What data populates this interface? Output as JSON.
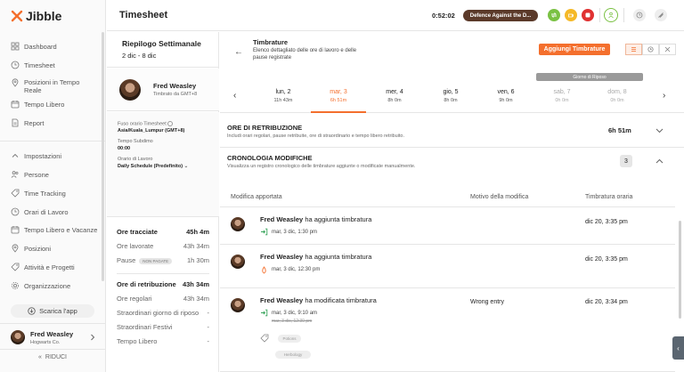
{
  "brand": {
    "name": "Jibble"
  },
  "sidebar": {
    "items_top": [
      {
        "label": "Dashboard",
        "icon": "grid-icon"
      },
      {
        "label": "Timesheet",
        "icon": "clock-icon"
      },
      {
        "label": "Posizioni in Tempo Reale",
        "icon": "location-icon"
      },
      {
        "label": "Tempo Libero",
        "icon": "calendar-icon"
      },
      {
        "label": "Report",
        "icon": "report-icon"
      }
    ],
    "items_bottom": [
      {
        "label": "Impostazioni",
        "icon": "chevron-up-icon"
      },
      {
        "label": "Persone",
        "icon": "people-icon"
      },
      {
        "label": "Time Tracking",
        "icon": "tag-icon"
      },
      {
        "label": "Orari di Lavoro",
        "icon": "clock-icon"
      },
      {
        "label": "Tempo Libero e Vacanze",
        "icon": "calendar-icon"
      },
      {
        "label": "Posizioni",
        "icon": "location-icon"
      },
      {
        "label": "Attività e Progetti",
        "icon": "tag-icon"
      },
      {
        "label": "Organizzazione",
        "icon": "gear-icon"
      }
    ],
    "import_label": "Scarica l'app",
    "user": {
      "name": "Fred Weasley",
      "org": "Hogwarts Co."
    },
    "reduce_label": "RIDUCI"
  },
  "header": {
    "title": "Timesheet",
    "timer": "0:52:02",
    "project": "Defence Against the D..."
  },
  "weekly": {
    "title": "Riepilogo Settimanale",
    "range": "2 dic - 8 dic",
    "user": {
      "name": "Fred Weasley",
      "tz": "Timbrato da GMT+8"
    },
    "info": {
      "tz_label": "Fuso orario Timesheet",
      "tz_value": "Asia/Kuala_Lumpur (GMT+8)",
      "buffer_label": "Tempo Subdimo",
      "buffer_value": "00:00",
      "schedule_label": "Orario di Lavoro",
      "schedule_value": "Daily Schedule (Predefinito)"
    },
    "stats_a": [
      {
        "label": "Ore tracciate",
        "value": "45h 4m",
        "bold": true
      },
      {
        "label": "Ore lavorate",
        "value": "43h 34m",
        "bold": false
      },
      {
        "label": "Pause",
        "value": "1h 30m",
        "bold": false,
        "badge": "NON PAGATE"
      }
    ],
    "stats_b": [
      {
        "label": "Ore di retribuzione",
        "value": "43h 34m",
        "bold": true
      },
      {
        "label": "Ore regolari",
        "value": "43h 34m",
        "bold": false
      },
      {
        "label": "Straordinari giorno di riposo",
        "value": "-",
        "bold": false
      },
      {
        "label": "Straordinari Festivi",
        "value": "-",
        "bold": false
      },
      {
        "label": "Tempo Libero",
        "value": "-",
        "bold": false
      }
    ]
  },
  "main": {
    "title": "Timbrature",
    "description": "Elenco dettagliato delle ore di lavoro e delle pause registrate",
    "add_label": "Aggiungi Timbrature",
    "rest_badge": "Giorno di Riposo",
    "days": [
      {
        "name": "lun, 2",
        "hours": "11h 43m",
        "state": "normal"
      },
      {
        "name": "mar, 3",
        "hours": "6h 51m",
        "state": "active"
      },
      {
        "name": "mer, 4",
        "hours": "8h 0m",
        "state": "normal"
      },
      {
        "name": "gio, 5",
        "hours": "8h 0m",
        "state": "normal"
      },
      {
        "name": "ven, 6",
        "hours": "9h 0m",
        "state": "normal"
      },
      {
        "name": "sab, 7",
        "hours": "0h 0m",
        "state": "muted"
      },
      {
        "name": "dom, 8",
        "hours": "0h 0m",
        "state": "muted"
      }
    ],
    "pay": {
      "title": "ORE DI RETRIBUZIONE",
      "subtitle": "Includi orari regolari, pause retribuite, ore di straordinario e tempo libero retribuito.",
      "value": "6h 51m"
    },
    "history": {
      "title": "CRONOLOGIA MODIFICHE",
      "subtitle": "Visualizza un registro cronologico delle timbrature aggiunte o modificate manualmente.",
      "count": "3"
    },
    "columns": [
      "Modifica apportata",
      "Motivo della modifica",
      "Timbratura oraria"
    ],
    "rows": [
      {
        "user": "Fred Weasley",
        "action": "ha aggiunta timbratura",
        "detail": "mar, 3 dic, 1:30 pm",
        "reason": "",
        "time": "dic 20, 3:35 pm",
        "icon": "clock-in-icon"
      },
      {
        "user": "Fred Weasley",
        "action": "ha aggiunta timbratura",
        "detail": "mar, 3 dic, 12:30 pm",
        "reason": "",
        "time": "dic 20, 3:35 pm",
        "icon": "break-icon"
      },
      {
        "user": "Fred Weasley",
        "action": "ha modificata timbratura",
        "detail": "mar, 3 dic, 9:10 am",
        "old": "mar, 3 dic, 12:30 pm",
        "reason": "Wrong entry",
        "time": "dic 20, 3:34 pm",
        "icon": "clock-in-icon"
      }
    ],
    "tags": [
      "Potions",
      "Herbology"
    ]
  }
}
